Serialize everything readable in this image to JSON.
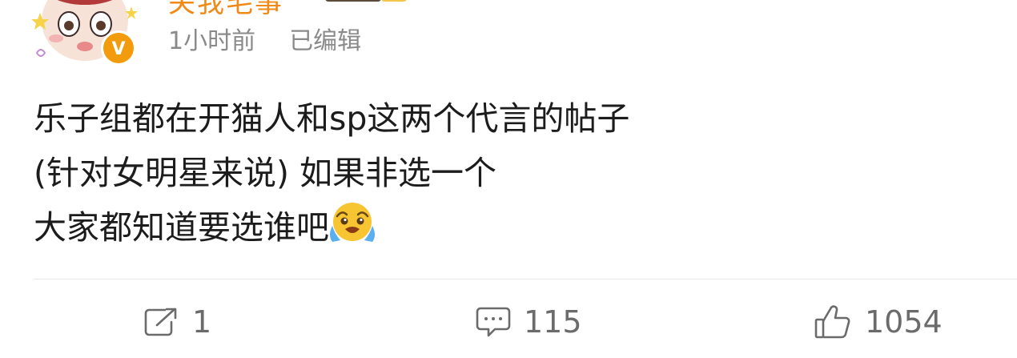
{
  "author": {
    "name": "关我毛事",
    "avatar_icon": "cartoon-avatar",
    "verified_icon": "verified-v-badge-icon",
    "verified_badge_text": "V",
    "colors": {
      "name": "#f08a17",
      "verified": "#f29b0c"
    }
  },
  "meta": {
    "time": "1小时前",
    "edited": "已编辑"
  },
  "content": {
    "lines": [
      "乐子组都在开猫人和sp这两个代言的帖子",
      "(针对女明星来说) 如果非选一个",
      "大家都知道要选谁吧"
    ],
    "trailing_emoji": "crying-face-emoji"
  },
  "actions": {
    "repost": {
      "icon": "repost-icon",
      "count": "1"
    },
    "comment": {
      "icon": "comment-icon",
      "count": "115"
    },
    "like": {
      "icon": "thumbs-up-icon",
      "count": "1054"
    }
  }
}
